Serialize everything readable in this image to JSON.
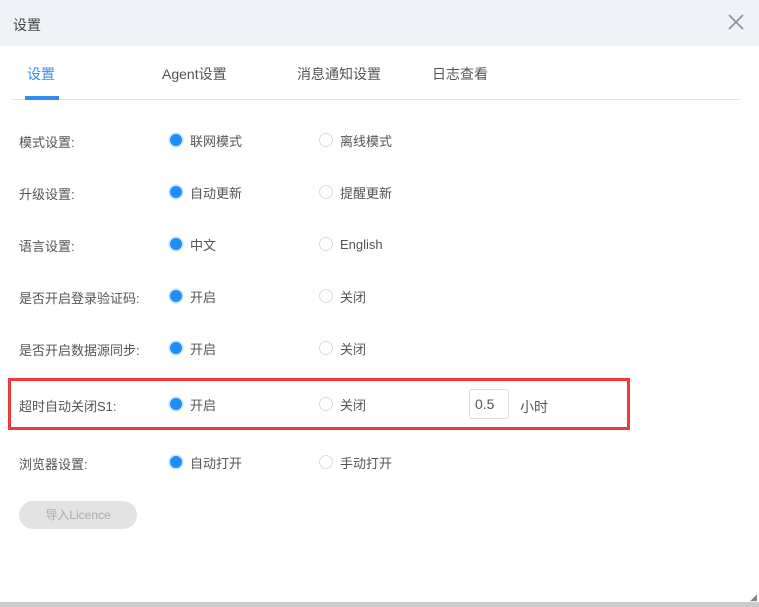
{
  "dialog": {
    "title": "设置"
  },
  "tabs": [
    {
      "label": "设置",
      "active": true
    },
    {
      "label": "Agent设置"
    },
    {
      "label": "消息通知设置"
    },
    {
      "label": "日志查看"
    }
  ],
  "settings": [
    {
      "label": "模式设置:",
      "options": [
        "联网模式",
        "离线模式"
      ],
      "selected": 0
    },
    {
      "label": "升级设置:",
      "options": [
        "自动更新",
        "提醒更新"
      ],
      "selected": 0
    },
    {
      "label": "语言设置:",
      "options": [
        "中文",
        "English"
      ],
      "selected": 0
    },
    {
      "label": "是否开启登录验证码:",
      "options": [
        "开启",
        "关闭"
      ],
      "selected": 0
    },
    {
      "label": "是否开启数据源同步:",
      "options": [
        "开启",
        "关闭"
      ],
      "selected": 0
    },
    {
      "label": "超时自动关闭S1:",
      "options": [
        "开启",
        "关闭"
      ],
      "selected": 0,
      "timeout_value": "0.5",
      "unit": "小时"
    },
    {
      "label": "浏览器设置:",
      "options": [
        "自动打开",
        "手动打开"
      ],
      "selected": 0
    }
  ],
  "import_button": "导入Licence",
  "colors": {
    "accent": "#2d8cf0",
    "highlight": "#f03a3a"
  }
}
